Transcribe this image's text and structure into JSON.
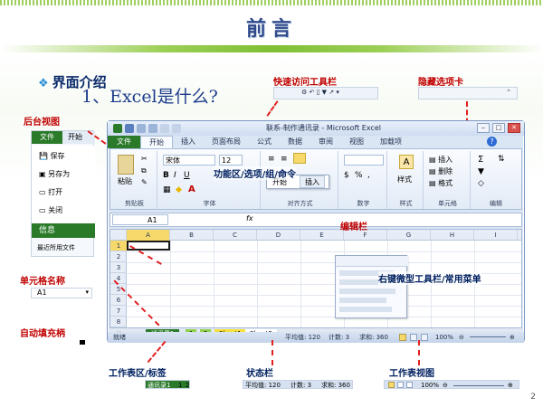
{
  "slide": {
    "title": "前言",
    "bullet": "界面介绍",
    "subtitle": "1、Excel是什么?",
    "page_number": "2"
  },
  "labels": {
    "qat": "快速访问工具栏",
    "hidden_tab": "隐藏选项卡",
    "backstage": "后台视图",
    "ribbon": "功能区/选项/组/命令",
    "edit_bar": "编辑栏",
    "name_box": "单元格名称",
    "autofill": "自动填充柄",
    "context_menu": "右键微型工具栏/常用菜单",
    "sheet_tabs": "工作表区/标签",
    "status_bar": "状态栏",
    "views": "工作表视图"
  },
  "backstage_thumb": {
    "tabs": [
      "文件",
      "开始"
    ],
    "items": [
      "保存",
      "另存为",
      "打开",
      "关闭"
    ],
    "section": "信息",
    "recent": "最近所用文件"
  },
  "window": {
    "title": "联系-制作通讯录 - Microsoft Excel",
    "tabs": [
      "文件",
      "开始",
      "插入",
      "页面布局",
      "公式",
      "数据",
      "审阅",
      "视图",
      "加载项"
    ],
    "ribbon_groups": [
      "剪贴板",
      "字体",
      "对齐方式",
      "数字",
      "样式",
      "单元格",
      "编辑"
    ],
    "font_name": "宋体",
    "font_size": "12",
    "paste_label": "粘贴",
    "style_label": "样式",
    "cell_cmds": [
      "插入",
      "删除",
      "格式"
    ],
    "mini_tabs": [
      "开始",
      "插入"
    ],
    "name_box": "A1",
    "columns": [
      "A",
      "B",
      "C",
      "D",
      "E",
      "F",
      "G",
      "H",
      "I"
    ],
    "rows": [
      "1",
      "2",
      "3",
      "4",
      "5",
      "6",
      "7",
      "8"
    ],
    "sheet_tabs": [
      "通讯录1",
      "1",
      "2",
      "Sheet1",
      "Sheet3"
    ],
    "status_ready": "就绪",
    "status_avg": "平均值: 120",
    "status_count": "计数: 3",
    "status_sum": "求和: 360",
    "zoom": "100%"
  },
  "name_thumb": {
    "value": "A1"
  },
  "sheet_thumb": {
    "tabs": [
      "通讯录1",
      "1",
      "2"
    ]
  },
  "status_thumb": {
    "avg": "平均值: 120",
    "count": "计数: 3",
    "sum": "求和: 360"
  },
  "views_thumb": {
    "zoom": "100%"
  },
  "colors": {
    "accent": "#2a7a2a",
    "label": "#c00000",
    "title": "#2e4a8a"
  }
}
